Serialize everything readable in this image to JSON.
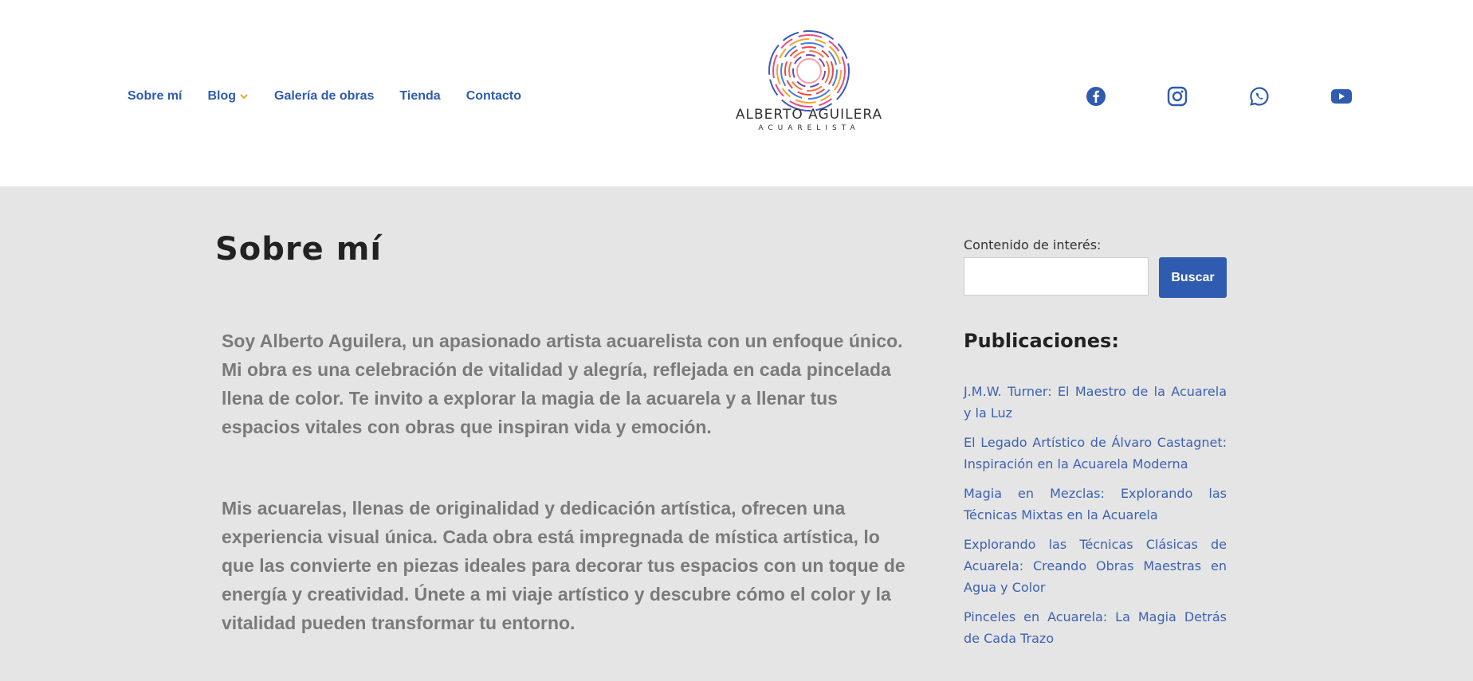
{
  "nav": {
    "items": [
      {
        "label": "Sobre mí"
      },
      {
        "label": "Blog",
        "has_dropdown": true
      },
      {
        "label": "Galería de obras"
      },
      {
        "label": "Tienda"
      },
      {
        "label": "Contacto"
      }
    ]
  },
  "logo": {
    "name": "ALBERTO AGUILERA",
    "subtitle": "ACUARELISTA"
  },
  "social": [
    {
      "icon": "facebook-icon"
    },
    {
      "icon": "instagram-icon"
    },
    {
      "icon": "whatsapp-icon"
    },
    {
      "icon": "youtube-icon"
    }
  ],
  "page": {
    "title": "Sobre mí",
    "paragraphs": [
      "Soy Alberto Aguilera, un apasionado artista acuarelista con un enfoque único. Mi obra es una celebración de vitalidad y alegría, reflejada en cada pincelada llena de color. Te invito a explorar la magia de la acuarela y a llenar tus espacios vitales con obras que inspiran vida y emoción.",
      "Mis acuarelas, llenas de originalidad y dedicación artística, ofrecen una experiencia visual única. Cada obra está impregnada de mística artística, lo que las convierte en piezas ideales para decorar tus espacios con un toque de energía y creatividad. Únete a mi viaje artístico y descubre cómo el color y la vitalidad pueden transformar tu entorno."
    ]
  },
  "sidebar": {
    "search_label": "Contenido de interés:",
    "search_placeholder": "",
    "search_button": "Buscar",
    "posts_title": "Publicaciones:",
    "posts": [
      "J.M.W. Turner: El Maestro de la Acuarela y la Luz",
      "El Legado Artístico de Álvaro Castagnet: Inspiración en la Acuarela Moderna",
      "Magia en Mezclas: Explorando las Técnicas Mixtas en la Acuarela",
      "Explorando las Técnicas Clásicas de Acuarela: Creando Obras Maestras en Agua y Color",
      "Pinceles en Acuarela: La Magia Detrás de Cada Trazo"
    ]
  },
  "colors": {
    "accent": "#2f5bb0",
    "link": "#3d62b0",
    "chevron": "#f0a030",
    "background": "#e5e5e5"
  }
}
